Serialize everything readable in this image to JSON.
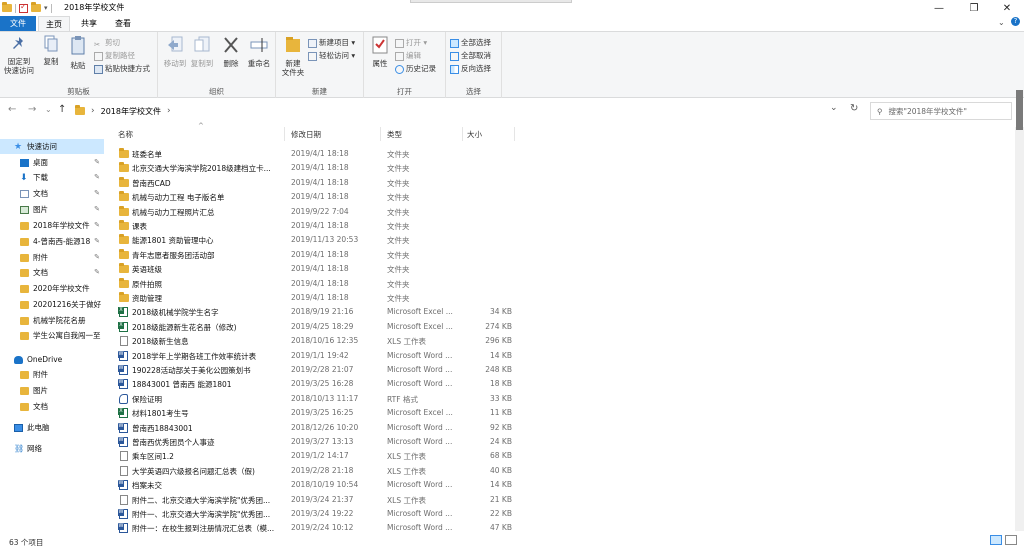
{
  "window": {
    "title": "2018年学校文件",
    "minimize": "—",
    "maximize": "❐",
    "close": "✕"
  },
  "tabs": {
    "file": "文件",
    "home": "主页",
    "share": "共享",
    "view": "查看"
  },
  "ribbon": {
    "clipboard": {
      "label": "剪贴板",
      "pin": "固定到\n快速访问",
      "copy": "复制",
      "paste": "粘贴",
      "cut": "剪切",
      "copy_path": "复制路径",
      "paste_shortcut": "粘贴快捷方式"
    },
    "organize": {
      "label": "组织",
      "move_to": "移动到",
      "copy_to": "复制到",
      "delete": "删除",
      "rename": "重命名"
    },
    "new": {
      "label": "新建",
      "new_folder": "新建\n文件夹",
      "new_item": "新建项目 ▾",
      "easy_access": "轻松访问 ▾"
    },
    "open": {
      "label": "打开",
      "properties": "属性",
      "open": "打开 ▾",
      "edit": "编辑",
      "history": "历史记录"
    },
    "select": {
      "label": "选择",
      "select_all": "全部选择",
      "select_none": "全部取消",
      "invert": "反向选择"
    }
  },
  "address": {
    "back": "←",
    "forward": "→",
    "recent": "⌄",
    "up": "↑",
    "path": "2018年学校文件",
    "chevron": "›",
    "dropdown": "⌄",
    "refresh": "↻",
    "search_placeholder": "搜索\"2018年学校文件\"",
    "search_icon": "⚲"
  },
  "sidebar": {
    "items": [
      {
        "label": "快速访问",
        "icon": "star",
        "sel": true
      },
      {
        "label": "桌面",
        "icon": "desktop",
        "pin": true
      },
      {
        "label": "下载",
        "icon": "download",
        "pin": true
      },
      {
        "label": "文档",
        "icon": "doc",
        "pin": true
      },
      {
        "label": "图片",
        "icon": "pic",
        "pin": true
      },
      {
        "label": "2018年学校文件",
        "icon": "folder",
        "pin": true
      },
      {
        "label": "4-曾南西-能源18",
        "icon": "folder",
        "pin": true
      },
      {
        "label": "附件",
        "icon": "folder",
        "pin": true
      },
      {
        "label": "文档",
        "icon": "folder",
        "pin": true
      },
      {
        "label": "2020年学校文件",
        "icon": "folder"
      },
      {
        "label": "20201216关于做好",
        "icon": "folder"
      },
      {
        "label": "机械学院花名册",
        "icon": "folder"
      },
      {
        "label": "学生公寓自我闯一至",
        "icon": "folder"
      },
      {
        "label": "OneDrive",
        "icon": "cloud"
      },
      {
        "label": "附件",
        "icon": "folder"
      },
      {
        "label": "图片",
        "icon": "folder"
      },
      {
        "label": "文档",
        "icon": "folder"
      },
      {
        "label": "此电脑",
        "icon": "pc"
      },
      {
        "label": "网络",
        "icon": "network"
      }
    ],
    "pin_glyph": "✎"
  },
  "columns": {
    "name": "名称",
    "date": "修改日期",
    "type": "类型",
    "size": "大小",
    "sort_glyph": "^"
  },
  "files": [
    {
      "name": "班委名单",
      "date": "2019/4/1 18:18",
      "type": "文件夹",
      "size": "",
      "kind": "folder"
    },
    {
      "name": "北京交通大学海滨学院2018级建档立卡...",
      "date": "2019/4/1 18:18",
      "type": "文件夹",
      "size": "",
      "kind": "folder"
    },
    {
      "name": "曾南西CAD",
      "date": "2019/4/1 18:18",
      "type": "文件夹",
      "size": "",
      "kind": "folder"
    },
    {
      "name": "机械与动力工程 电子版名单",
      "date": "2019/4/1 18:18",
      "type": "文件夹",
      "size": "",
      "kind": "folder"
    },
    {
      "name": "机械与动力工程照片汇总",
      "date": "2019/9/22 7:04",
      "type": "文件夹",
      "size": "",
      "kind": "folder"
    },
    {
      "name": "课表",
      "date": "2019/4/1 18:18",
      "type": "文件夹",
      "size": "",
      "kind": "folder"
    },
    {
      "name": "能源1801 资助管理中心",
      "date": "2019/11/13 20:53",
      "type": "文件夹",
      "size": "",
      "kind": "folder"
    },
    {
      "name": "青年志愿者服务团活动部",
      "date": "2019/4/1 18:18",
      "type": "文件夹",
      "size": "",
      "kind": "folder"
    },
    {
      "name": "英语班级",
      "date": "2019/4/1 18:18",
      "type": "文件夹",
      "size": "",
      "kind": "folder"
    },
    {
      "name": "原件拍照",
      "date": "2019/4/1 18:18",
      "type": "文件夹",
      "size": "",
      "kind": "folder"
    },
    {
      "name": "资助管理",
      "date": "2019/4/1 18:18",
      "type": "文件夹",
      "size": "",
      "kind": "folder"
    },
    {
      "name": "2018级机械学院学生名字",
      "date": "2018/9/19 21:16",
      "type": "Microsoft Excel ...",
      "size": "34 KB",
      "kind": "excel"
    },
    {
      "name": "2018级能源新生花名册（修改)",
      "date": "2019/4/25 18:29",
      "type": "Microsoft Excel ...",
      "size": "274 KB",
      "kind": "excel"
    },
    {
      "name": "2018级新生信息",
      "date": "2018/10/16 12:35",
      "type": "XLS 工作表",
      "size": "296 KB",
      "kind": "doc"
    },
    {
      "name": "2018学年上学期各班工作效率统计表",
      "date": "2019/1/1 19:42",
      "type": "Microsoft Word ...",
      "size": "14 KB",
      "kind": "word"
    },
    {
      "name": "190228活动部关于美化公园策划书",
      "date": "2019/2/28 21:07",
      "type": "Microsoft Word ...",
      "size": "248 KB",
      "kind": "word"
    },
    {
      "name": "18843001 曾南西 能源1801",
      "date": "2019/3/25 16:28",
      "type": "Microsoft Word ...",
      "size": "18 KB",
      "kind": "word"
    },
    {
      "name": "保险证明",
      "date": "2018/10/13 11:17",
      "type": "RTF 格式",
      "size": "33 KB",
      "kind": "rtf"
    },
    {
      "name": "材料1801考生号",
      "date": "2019/3/25 16:25",
      "type": "Microsoft Excel ...",
      "size": "11 KB",
      "kind": "excel"
    },
    {
      "name": "曾南西18843001",
      "date": "2018/12/26 10:20",
      "type": "Microsoft Word ...",
      "size": "92 KB",
      "kind": "word"
    },
    {
      "name": "曾南西优秀团员个人事迹",
      "date": "2019/3/27 13:13",
      "type": "Microsoft Word ...",
      "size": "24 KB",
      "kind": "word"
    },
    {
      "name": "乘车区间1.2",
      "date": "2019/1/2 14:17",
      "type": "XLS 工作表",
      "size": "68 KB",
      "kind": "doc"
    },
    {
      "name": "大学英语四六级报名问题汇总表（假)",
      "date": "2019/2/28 21:18",
      "type": "XLS 工作表",
      "size": "40 KB",
      "kind": "doc"
    },
    {
      "name": "档案未交",
      "date": "2018/10/19 10:54",
      "type": "Microsoft Word ...",
      "size": "14 KB",
      "kind": "word"
    },
    {
      "name": "附件二、北京交通大学海滨学院\"优秀团...",
      "date": "2019/3/24 21:37",
      "type": "XLS 工作表",
      "size": "21 KB",
      "kind": "doc"
    },
    {
      "name": "附件一、北京交通大学海滨学院\"优秀团...",
      "date": "2019/3/24 19:22",
      "type": "Microsoft Word ...",
      "size": "22 KB",
      "kind": "word"
    },
    {
      "name": "附件一：在校生报到注册情况汇总表（模...",
      "date": "2019/2/24 10:12",
      "type": "Microsoft Word ...",
      "size": "47 KB",
      "kind": "word"
    }
  ],
  "status": {
    "count": "63 个项目"
  }
}
